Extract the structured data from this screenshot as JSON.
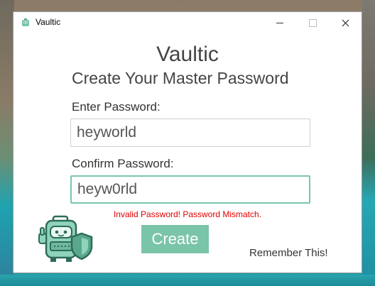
{
  "window": {
    "title": "Vaultic",
    "controls": {
      "minimize": "minimize",
      "maximize": "maximize",
      "close": "close"
    }
  },
  "main": {
    "app_name": "Vaultic",
    "subtitle": "Create Your Master Password",
    "enter_label": "Enter Password:",
    "enter_value": "heyworld",
    "confirm_label": "Confirm Password:",
    "confirm_value": "heyw0rld",
    "error": "Invalid Password! Password Mismatch.",
    "create_label": "Create",
    "remember_label": "Remember This!"
  },
  "colors": {
    "accent": "#7ac4a8",
    "error": "#e00000",
    "focus_border": "#79c6aa"
  },
  "icons": {
    "app": "vault-robot-icon",
    "mascot": "robot-with-shield-icon"
  }
}
